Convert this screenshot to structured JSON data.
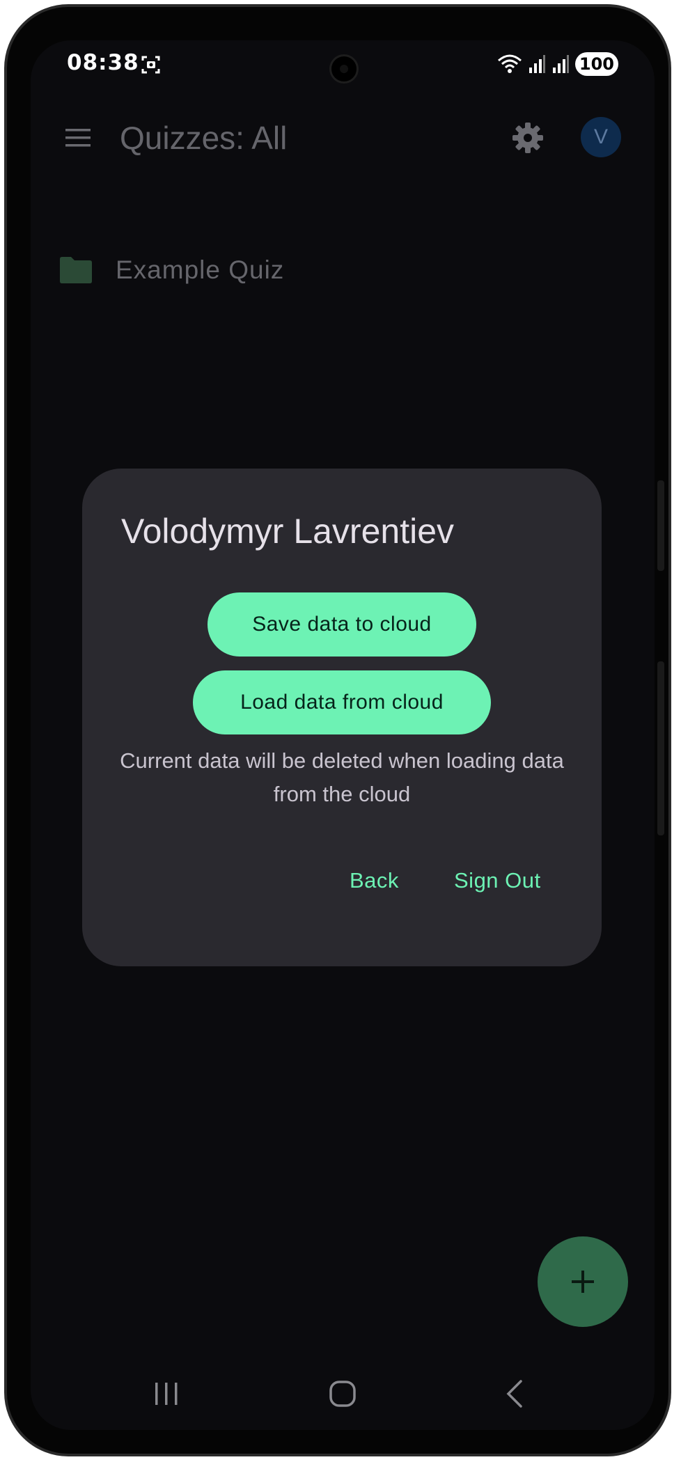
{
  "status_bar": {
    "time": "08:38",
    "battery": "100"
  },
  "app_bar": {
    "title": "Quizzes: All",
    "avatar_initial": "V"
  },
  "quiz_list": [
    {
      "label": "Example Quiz",
      "icon": "folder-icon"
    }
  ],
  "dialog": {
    "title": "Volodymyr Lavrentiev",
    "save_label": "Save data to cloud",
    "load_label": "Load data from cloud",
    "note": "Current data will be deleted when loading data from the cloud",
    "back_label": "Back",
    "signout_label": "Sign Out"
  },
  "colors": {
    "accent": "#6df2b4",
    "dialog_bg": "#2a292f",
    "screen_bg": "#0b0b0e",
    "fab_bg": "#2f6a4a",
    "avatar_bg": "#0e2b4d"
  },
  "icons": {
    "menu": "menu-icon",
    "settings": "gear-icon",
    "fab": "plus-icon",
    "nav_recent": "recent-apps-icon",
    "nav_home": "home-icon",
    "nav_back": "back-icon"
  }
}
